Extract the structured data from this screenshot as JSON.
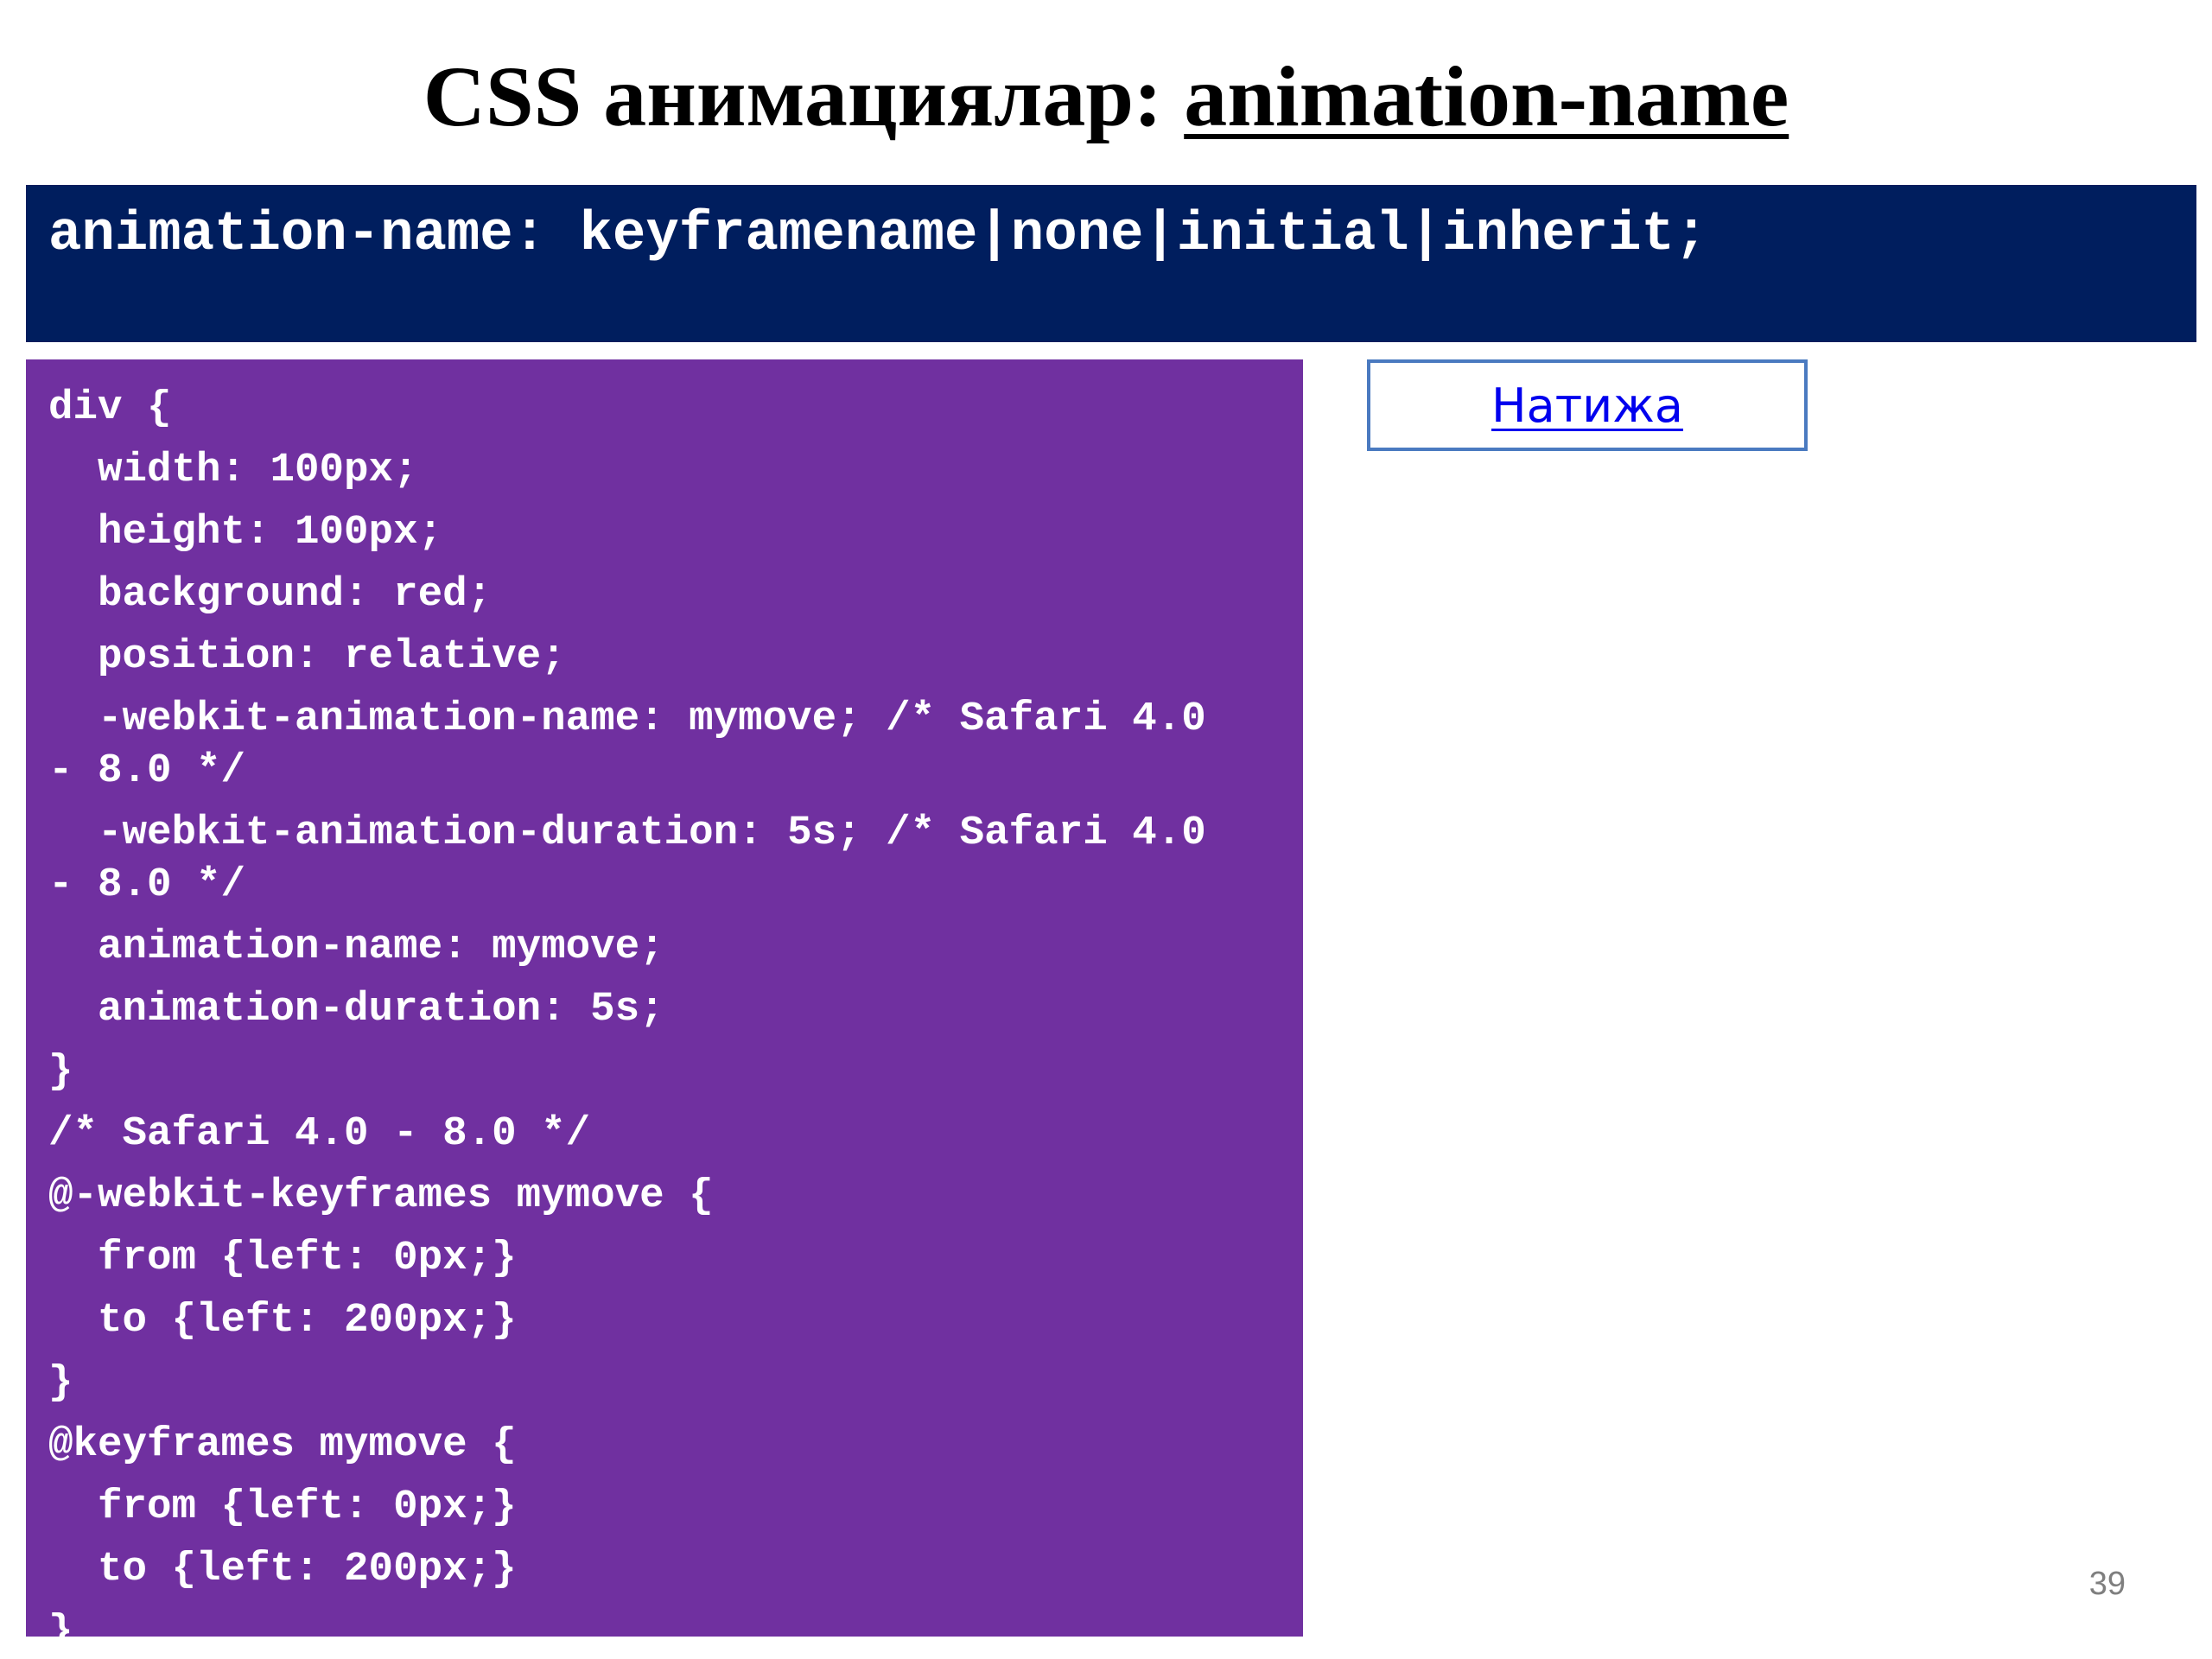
{
  "slide": {
    "title_prefix": "CSS анимациялар: ",
    "title_underlined": "animation-name",
    "syntax": "animation-name: keyframename|none|initial|inherit;",
    "code_lines": [
      "div {",
      "  width: 100px;",
      "  height: 100px;",
      "  background: red;",
      "  position: relative;",
      "  -webkit-animation-name: mymove; /* Safari 4.0",
      "- 8.0 */",
      "  -webkit-animation-duration: 5s; /* Safari 4.0",
      "- 8.0 */",
      "  animation-name: mymove;",
      "  animation-duration: 5s;",
      "}",
      "/* Safari 4.0 - 8.0 */",
      "@-webkit-keyframes mymove {",
      "  from {left: 0px;}",
      "  to {left: 200px;}",
      "}",
      "@keyframes mymove {",
      "  from {left: 0px;}",
      "  to {left: 200px;}",
      "}"
    ],
    "result_link": "Натижа",
    "page_number": "39"
  },
  "colors": {
    "syntax_bg": "#001e5e",
    "code_bg": "#7030a0",
    "link": "#0000ee"
  }
}
